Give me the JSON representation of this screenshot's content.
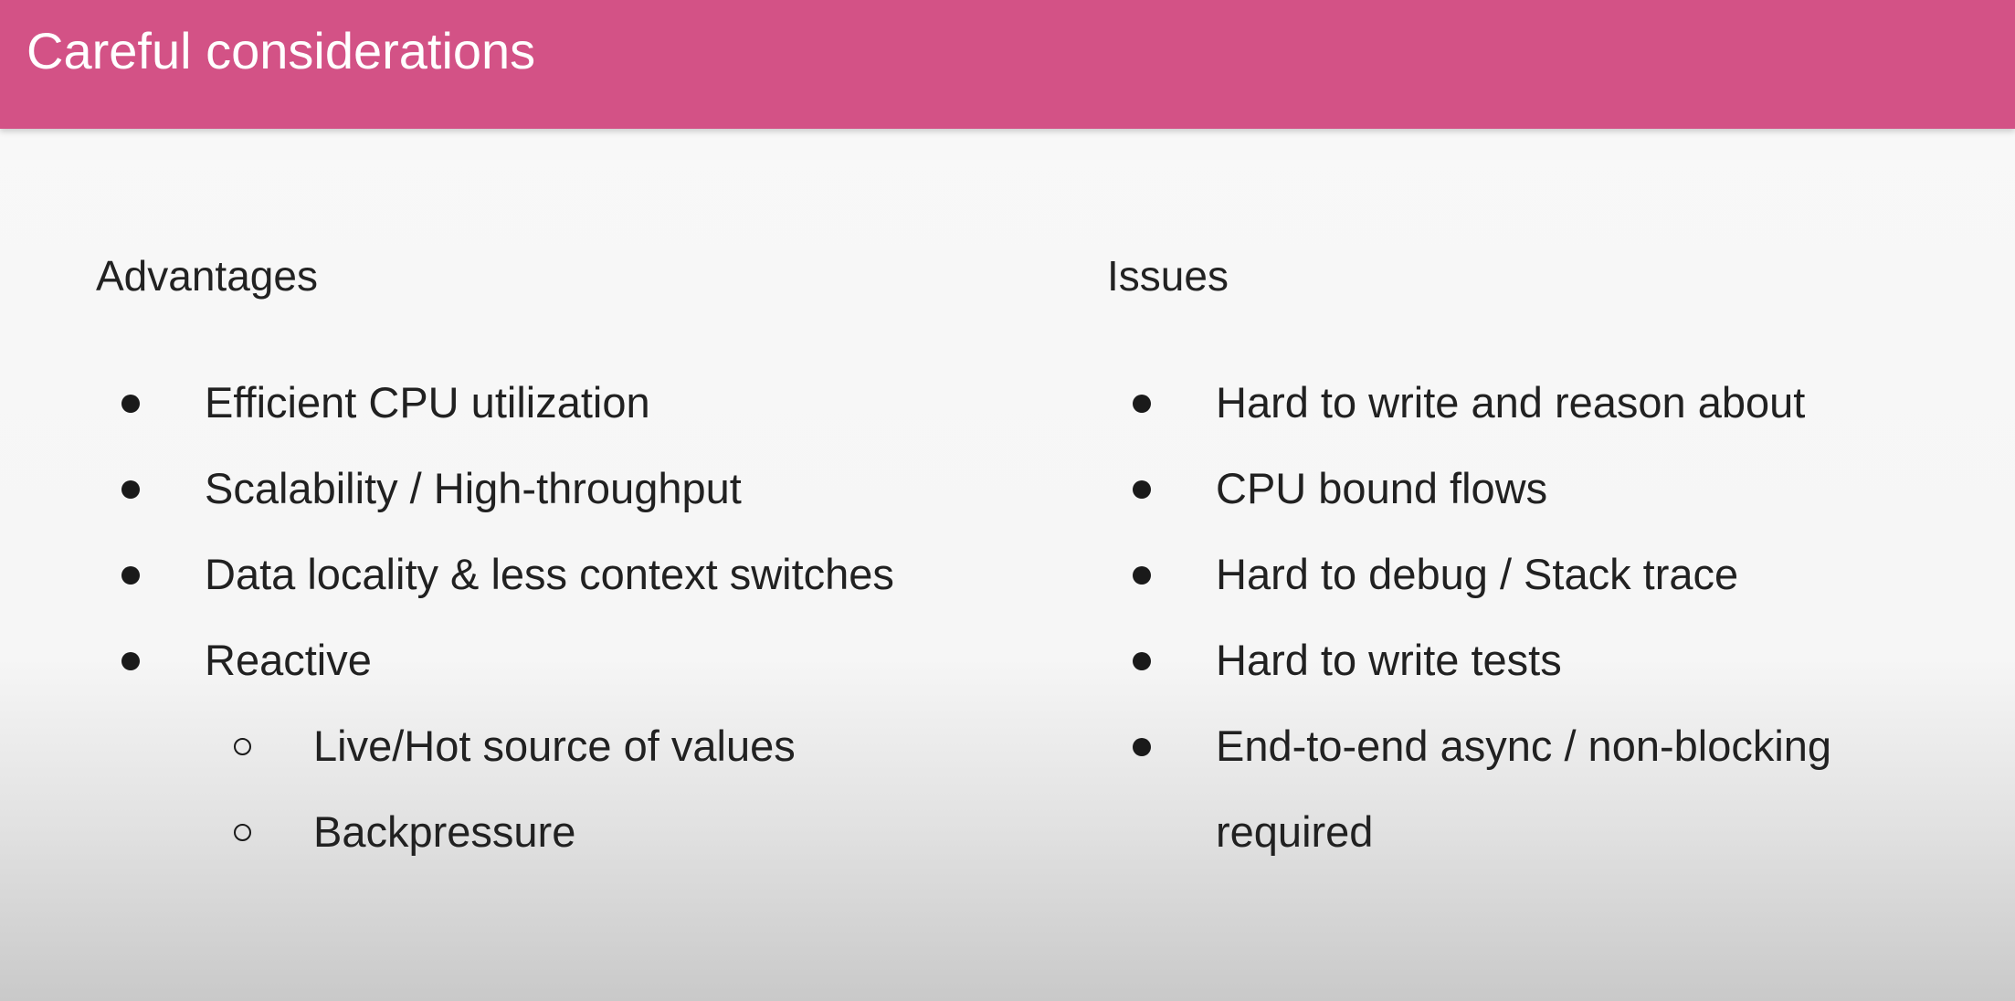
{
  "slide": {
    "title": "Careful considerations",
    "header_color": "#d35286"
  },
  "advantages": {
    "heading": "Advantages",
    "items": [
      "Efficient CPU utilization",
      "Scalability / High-throughput",
      "Data locality & less context switches",
      "Reactive"
    ],
    "sub_items": [
      "Live/Hot source of values",
      "Backpressure"
    ]
  },
  "issues": {
    "heading": "Issues",
    "items": [
      "Hard to write and reason about",
      "CPU bound flows",
      "Hard to debug / Stack trace",
      "Hard to write tests",
      "End-to-end async / non-blocking"
    ],
    "last_item_continuation": "required"
  }
}
